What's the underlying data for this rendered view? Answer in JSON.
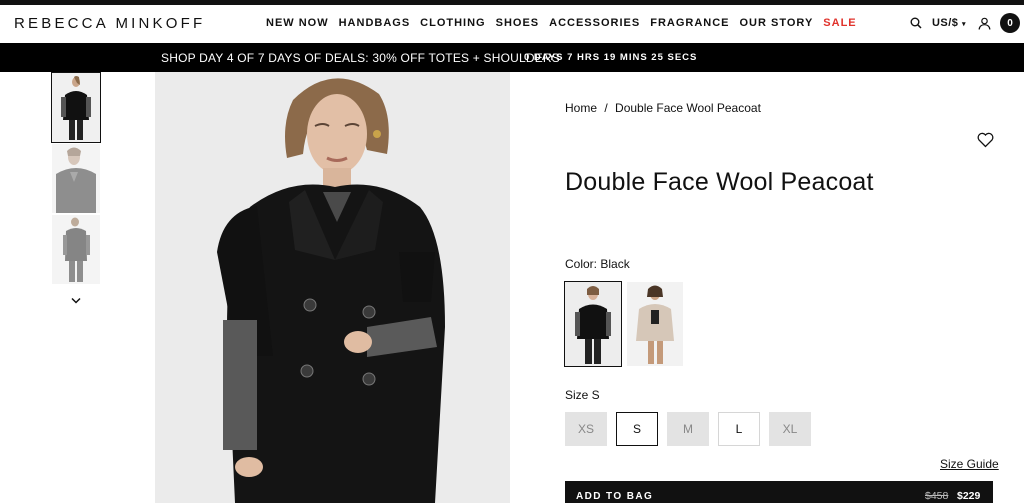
{
  "brand": {
    "logo": "REBECCA MINKOFF"
  },
  "nav": {
    "items": [
      {
        "label": "NEW NOW"
      },
      {
        "label": "HANDBAGS"
      },
      {
        "label": "CLOTHING"
      },
      {
        "label": "SHOES"
      },
      {
        "label": "ACCESSORIES"
      },
      {
        "label": "FRAGRANCE"
      },
      {
        "label": "OUR STORY"
      },
      {
        "label": "SALE"
      }
    ],
    "sale_color": "#e0322b"
  },
  "header_tools": {
    "locale": "US/$",
    "cart_count": "0",
    "icons": [
      "search-icon",
      "chevron-down-icon",
      "user-icon",
      "cart-icon"
    ]
  },
  "promo": {
    "message": "SHOP DAY 4 OF 7 DAYS OF DEALS: 30% OFF TOTES + SHOULDERS",
    "countdown": "0 DAYS 7 HRS 19 MINS 25 SECS"
  },
  "product": {
    "breadcrumb": [
      "Home",
      "/",
      "Double Face Wool Peacoat"
    ],
    "title": "Double Face Wool Peacoat",
    "color_label": "Color: Black",
    "swatches": [
      "Black",
      "Beige"
    ],
    "size_label": "Size S",
    "sizes": [
      {
        "label": "XS",
        "state": "unavailable"
      },
      {
        "label": "S",
        "state": "selected"
      },
      {
        "label": "M",
        "state": "unavailable"
      },
      {
        "label": "L",
        "state": "available"
      },
      {
        "label": "XL",
        "state": "unavailable"
      }
    ],
    "size_guide": "Size Guide",
    "add_to_bag": "ADD TO BAG",
    "price_original": "$458",
    "price_sale": "$229"
  }
}
